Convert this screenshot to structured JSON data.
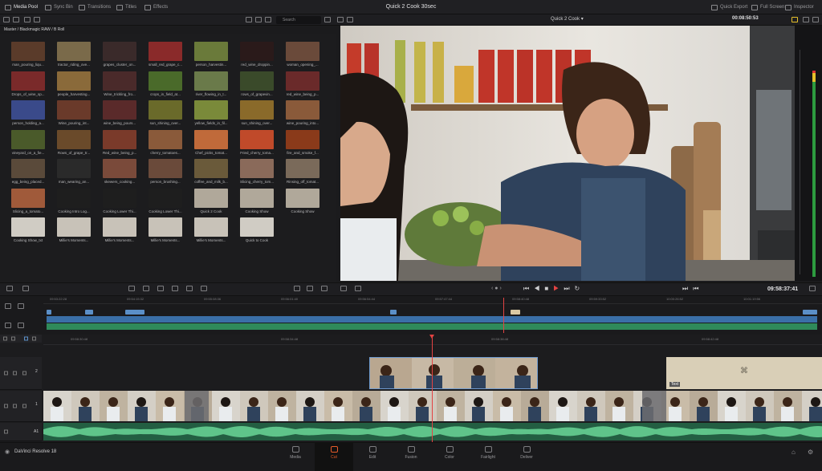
{
  "window": {
    "title": "Quick 2 Cook 30sec"
  },
  "top_toolbar": {
    "left": [
      {
        "label": "Media Pool",
        "icon": "media-pool-icon",
        "active": true
      },
      {
        "label": "Sync Bin",
        "icon": "sync-bin-icon",
        "active": false
      },
      {
        "label": "Transitions",
        "icon": "transitions-icon",
        "active": false
      },
      {
        "label": "Titles",
        "icon": "titles-icon",
        "active": false
      },
      {
        "label": "Effects",
        "icon": "effects-icon",
        "active": false
      }
    ],
    "right": [
      {
        "label": "Quick Export",
        "icon": "export-icon"
      },
      {
        "label": "Full Screen",
        "icon": "fullscreen-icon"
      },
      {
        "label": "Inspector",
        "icon": "inspector-icon"
      }
    ]
  },
  "secondary_toolbar": {
    "search_placeholder": "Search",
    "timeline_name": "Quick 2 Cook",
    "source_timecode": "00:08:50:53"
  },
  "media_pool": {
    "breadcrumb": "Master / Blackmagic RAW / B Roll",
    "clips": [
      "man_pouring_liqu...",
      "tractor_riding_ove...",
      "grapes_cluster_on...",
      "small_red_grape_c...",
      "person_harvestin...",
      "red_wine_droppin...",
      "woman_opening_...",
      "Drops_of_wine_sp...",
      "people_harvesting...",
      "Wine_trickling_fro...",
      "crops_in_field_at...",
      "river_flowing_in_t...",
      "rows_of_grapevin...",
      "red_wine_being_p...",
      "person_holding_a...",
      "Wine_pouring_int...",
      "wine_being_pours...",
      "sun_shining_over...",
      "yellow_fields_in_fil...",
      "sun_shining_over...",
      "wine_pouring_into...",
      "vineyard_on_a_fie...",
      "Rows_of_grape_tr...",
      "Red_wine_being_p...",
      "cherry_tomatoes...",
      "Chef_picks_tomat...",
      "Fried_cherry_toma...",
      "fire_and_smoke_f...",
      "egg_being_placed...",
      "man_wearing_an...",
      "skewers_cooking...",
      "person_brushing...",
      "coffee_and_milk_b...",
      "Slicing_cherry_tom...",
      "Rinsing_off_tomat...",
      "Slicing_a_tomato...",
      "Cooking Intro Log...",
      "Cooking Lower Thi...",
      "Cooking Lower Thi...",
      "Quick 2 Cook",
      "Cooking Show",
      "Cooking Show",
      "Cooking Show_txt",
      "Millie's Moments...",
      "Millie's Moments...",
      "Millie's Moments...",
      "Millie's Moments...",
      "Quick to Cook"
    ]
  },
  "transport": {
    "record_timecode": "09:58:37:41"
  },
  "upper_timeline": {
    "ruler": [
      "09:53:22:28",
      "09:54:15:32",
      "09:55:08:36",
      "09:56:01:40",
      "09:56:54:44",
      "09:57:47:44",
      "09:58:40:48",
      "09:59:33:52",
      "10:00:26:52",
      "10:01:19:56"
    ]
  },
  "lower_timeline": {
    "ruler": [
      "09:58:30:48",
      "09:58:34:48",
      "09:58:38:48",
      "09:58:42:48"
    ],
    "tracks": [
      {
        "label": "2"
      },
      {
        "label": "1"
      },
      {
        "label": "A1"
      }
    ],
    "title_clip_label": "Text"
  },
  "pages": [
    {
      "label": "Media",
      "icon": "media-page-icon",
      "active": false
    },
    {
      "label": "Cut",
      "icon": "cut-page-icon",
      "active": true
    },
    {
      "label": "Edit",
      "icon": "edit-page-icon",
      "active": false
    },
    {
      "label": "Fusion",
      "icon": "fusion-page-icon",
      "active": false
    },
    {
      "label": "Color",
      "icon": "color-page-icon",
      "active": false
    },
    {
      "label": "Fairlight",
      "icon": "fairlight-page-icon",
      "active": false
    },
    {
      "label": "Deliver",
      "icon": "deliver-page-icon",
      "active": false
    }
  ],
  "app": {
    "name": "DaVinci Resolve 18"
  },
  "colors": {
    "accent": "#e65c2a",
    "playhead": "#e34343",
    "video_clip": "#3a6fa7",
    "audio": "#2f8a5a"
  }
}
